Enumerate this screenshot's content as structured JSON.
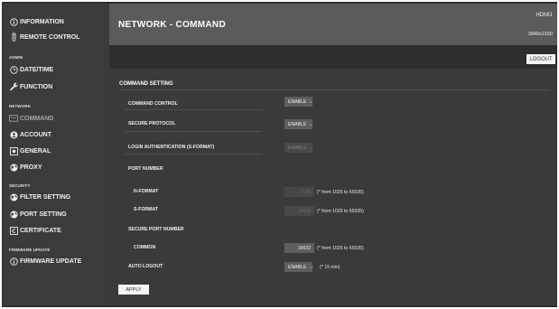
{
  "sidebar": {
    "information": "INFORMATION",
    "remote_control": "REMOTE CONTROL",
    "admin_head": "ADMIN",
    "date_time": "DATE/TIME",
    "function": "FUNCTION",
    "network_head": "NETWORK",
    "command": "COMMAND",
    "account": "ACCOUNT",
    "general": "GENERAL",
    "proxy": "PROXY",
    "security_head": "SECURITY",
    "filter_setting": "FILTER SETTING",
    "port_setting": "PORT SETTING",
    "certificate": "CERTIFICATE",
    "firmware_head": "FIRMWARE UPDATE",
    "firmware_update": "FIRMWARE UPDATE"
  },
  "header": {
    "title": "NETWORK - COMMAND",
    "input": "HDMI1",
    "resolution": "3840x2160",
    "logout": "LOGOUT"
  },
  "main": {
    "section_title": "COMMAND SETTING",
    "command_control": {
      "label": "COMMAND CONTROL",
      "value": "ENABLE"
    },
    "secure_protocol": {
      "label": "SECURE PROTOCOL",
      "value": "ENABLE"
    },
    "login_auth": {
      "label": "LOGIN AUTHENTICATION (S-FORMAT)",
      "value": "ENABLE"
    },
    "port_number_label": "PORT NUMBER",
    "n_format": {
      "label": "N-FORMAT",
      "value": "7142",
      "hint": "(* from 1025 to 65535)"
    },
    "s_format": {
      "label": "S-FORMAT",
      "value": "10008",
      "hint": "(* from 1025 to 65535)"
    },
    "secure_port_label": "SECURE PORT NUMBER",
    "common": {
      "label": "COMMON",
      "value": "10022",
      "hint": "(* from 1025 to 65535)"
    },
    "auto_logout": {
      "label": "AUTO LOGOUT",
      "value": "ENABLE",
      "hint": "(* 15 min)"
    },
    "apply": "APPLY"
  },
  "colors": {
    "frame": "#2e2e2e",
    "sidebar": "#3b3b3b",
    "header": "#5b5b5b",
    "content": "#3a3a3a",
    "select": "#5e5e5e",
    "button": "#f4f4f4"
  }
}
